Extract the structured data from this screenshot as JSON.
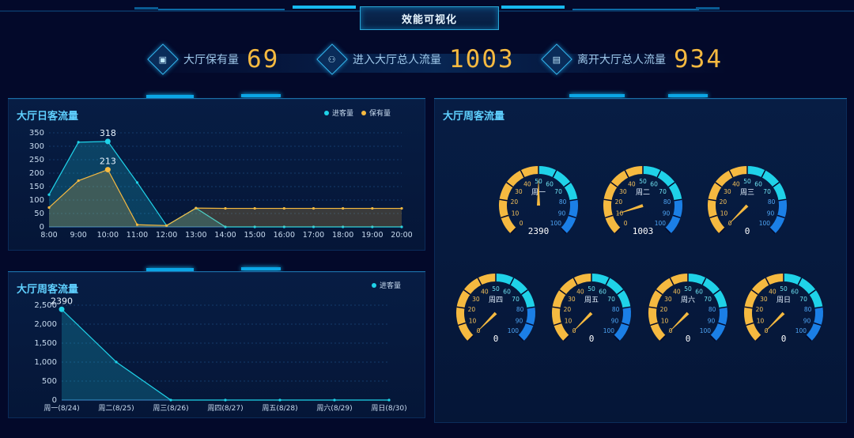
{
  "header": {
    "title": "效能可视化"
  },
  "kpis": [
    {
      "label": "大厅保有量",
      "value": "69",
      "icon": "monitor-icon"
    },
    {
      "label": "进入大厅总人流量",
      "value": "1003",
      "icon": "people-icon"
    },
    {
      "label": "离开大厅总人流量",
      "value": "934",
      "icon": "document-icon"
    }
  ],
  "daily_panel": {
    "title": "大厅日客流量",
    "legend": [
      "进客量",
      "保有量"
    ]
  },
  "weekly_panel": {
    "title": "大厅周客流量",
    "legend": [
      "进客量"
    ]
  },
  "gauge_panel": {
    "title": "大厅周客流量"
  },
  "colors": {
    "cyan": "#1fd2e8",
    "orange": "#f5b940",
    "blue": "#1b7fe6",
    "accent": "#0ba6e6"
  },
  "chart_data": [
    {
      "type": "area",
      "title": "大厅日客流量",
      "categories": [
        "8:00",
        "9:00",
        "10:00",
        "11:00",
        "12:00",
        "13:00",
        "14:00",
        "15:00",
        "16:00",
        "17:00",
        "18:00",
        "19:00",
        "20:00"
      ],
      "yticks": [
        "0",
        "50",
        "100",
        "150",
        "200",
        "250",
        "300",
        "350"
      ],
      "ylim": [
        0,
        350
      ],
      "series": [
        {
          "name": "进客量",
          "values": [
            120,
            315,
            318,
            165,
            5,
            70,
            0,
            0,
            0,
            0,
            0,
            0,
            0
          ],
          "peak_label": "318"
        },
        {
          "name": "保有量",
          "values": [
            72,
            172,
            213,
            8,
            5,
            70,
            69,
            69,
            69,
            69,
            69,
            69,
            69
          ],
          "peak_label": "213"
        }
      ]
    },
    {
      "type": "area",
      "title": "大厅周客流量",
      "categories": [
        "周一(8/24)",
        "周二(8/25)",
        "周三(8/26)",
        "周四(8/27)",
        "周五(8/28)",
        "周六(8/29)",
        "周日(8/30)"
      ],
      "yticks": [
        "0",
        "500",
        "1,000",
        "1,500",
        "2,000",
        "2,500"
      ],
      "ylim": [
        0,
        2500
      ],
      "series": [
        {
          "name": "进客量",
          "values": [
            2390,
            1003,
            0,
            0,
            0,
            0,
            0
          ],
          "peak_label": "2390"
        }
      ]
    },
    {
      "type": "gauge",
      "title": "大厅周客流量",
      "ticks": [
        "0",
        "10",
        "20",
        "30",
        "40",
        "50",
        "60",
        "70",
        "80",
        "90",
        "100"
      ],
      "gauges": [
        {
          "name": "周一",
          "display": "2390",
          "value": 50
        },
        {
          "name": "周二",
          "display": "1003",
          "value": 10
        },
        {
          "name": "周三",
          "display": "0",
          "value": 0
        },
        {
          "name": "周四",
          "display": "0",
          "value": 0
        },
        {
          "name": "周五",
          "display": "0",
          "value": 0
        },
        {
          "name": "周六",
          "display": "0",
          "value": 0
        },
        {
          "name": "周日",
          "display": "0",
          "value": 0
        }
      ]
    }
  ]
}
